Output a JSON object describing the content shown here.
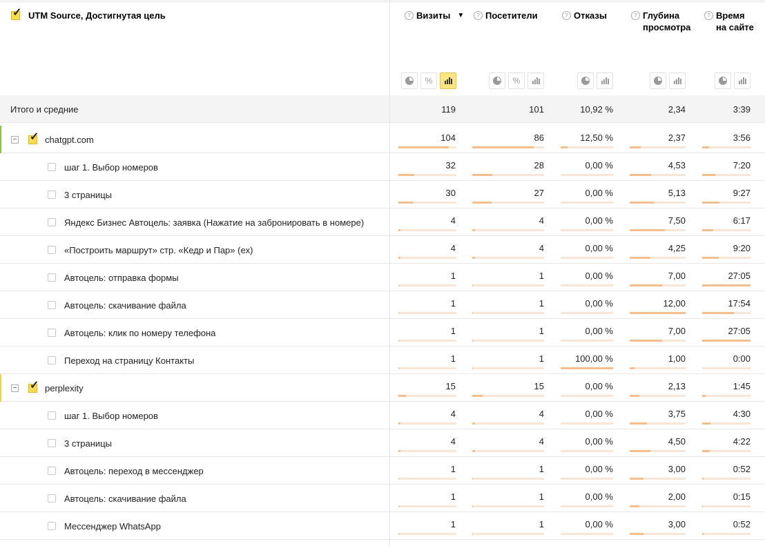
{
  "colors": {
    "accent": "#ffdc4d",
    "bar_bg": "#fbe6d4",
    "bar_fill": "#f5be8d",
    "group1_marker": "#8bc34a",
    "group2_marker": "#f1d34a"
  },
  "header": {
    "dimension": "UTM Source, Достигнутая цель",
    "help_icon": "?",
    "sort_indicator": "▼",
    "metrics": [
      {
        "title": "Визиты",
        "buttons": [
          "pie-icon",
          "percent-icon",
          "bars-icon"
        ],
        "active": "bars-icon",
        "sorted": true
      },
      {
        "title": "Посетители",
        "buttons": [
          "pie-icon",
          "percent-icon",
          "bars-icon"
        ]
      },
      {
        "title": "Отказы",
        "buttons": [
          "pie-icon",
          "bars-icon"
        ]
      },
      {
        "title": "Глубина просмотра",
        "buttons": [
          "pie-icon",
          "bars-icon"
        ]
      },
      {
        "title": "Время на сайте",
        "buttons": [
          "pie-icon",
          "bars-icon"
        ]
      }
    ]
  },
  "total": {
    "label": "Итого и средние",
    "values": [
      "119",
      "101",
      "10,92 %",
      "2,34",
      "3:39"
    ]
  },
  "groups": [
    {
      "label": "chatgpt.com",
      "values": [
        "104",
        "86",
        "12,50 %",
        "2,37",
        "3:56"
      ],
      "fills": [
        0.874,
        0.851,
        0.125,
        0.197,
        0.145
      ],
      "rows": [
        {
          "label": "шаг 1. Выбор номеров",
          "values": [
            "32",
            "28",
            "0,00 %",
            "4,53",
            "7:20"
          ],
          "fills": [
            0.269,
            0.277,
            0,
            0.378,
            0.272
          ]
        },
        {
          "label": "3 страницы",
          "values": [
            "30",
            "27",
            "0,00 %",
            "5,13",
            "9:27"
          ],
          "fills": [
            0.252,
            0.267,
            0,
            0.428,
            0.35
          ]
        },
        {
          "label": "Яндекс Бизнес Автоцель: заявка (Нажатие на забронировать в номере)",
          "values": [
            "4",
            "4",
            "0,00 %",
            "7,50",
            "6:17"
          ],
          "fills": [
            0.034,
            0.04,
            0,
            0.625,
            0.233
          ]
        },
        {
          "label": "«Построить маршрут» стр. «Кедр и Пар» (ex)",
          "values": [
            "4",
            "4",
            "0,00 %",
            "4,25",
            "9:20"
          ],
          "fills": [
            0.034,
            0.04,
            0,
            0.354,
            0.346
          ]
        },
        {
          "label": "Автоцель: отправка формы",
          "values": [
            "1",
            "1",
            "0,00 %",
            "7,00",
            "27:05"
          ],
          "fills": [
            0.008,
            0.01,
            0,
            0.583,
            1.0
          ]
        },
        {
          "label": "Автоцель: скачивание файла",
          "values": [
            "1",
            "1",
            "0,00 %",
            "12,00",
            "17:54"
          ],
          "fills": [
            0.008,
            0.01,
            0,
            1.0,
            0.661
          ]
        },
        {
          "label": "Автоцель: клик по номеру телефона",
          "values": [
            "1",
            "1",
            "0,00 %",
            "7,00",
            "27:05"
          ],
          "fills": [
            0.008,
            0.01,
            0,
            0.583,
            1.0
          ]
        },
        {
          "label": "Переход на страницу Контакты",
          "values": [
            "1",
            "1",
            "100,00 %",
            "1,00",
            "0:00"
          ],
          "fills": [
            0.008,
            0.01,
            1.0,
            0.083,
            0
          ]
        }
      ]
    },
    {
      "label": "perplexity",
      "values": [
        "15",
        "15",
        "0,00 %",
        "2,13",
        "1:45"
      ],
      "fills": [
        0.126,
        0.149,
        0,
        0.178,
        0.065
      ],
      "rows": [
        {
          "label": "шаг 1. Выбор номеров",
          "values": [
            "4",
            "4",
            "0,00 %",
            "3,75",
            "4:30"
          ],
          "fills": [
            0.034,
            0.04,
            0,
            0.313,
            0.166
          ]
        },
        {
          "label": "3 страницы",
          "values": [
            "4",
            "4",
            "0,00 %",
            "4,50",
            "4:22"
          ],
          "fills": [
            0.034,
            0.04,
            0,
            0.375,
            0.161
          ]
        },
        {
          "label": "Автоцель: переход в мессенджер",
          "values": [
            "1",
            "1",
            "0,00 %",
            "3,00",
            "0:52"
          ],
          "fills": [
            0.008,
            0.01,
            0,
            0.25,
            0.032
          ]
        },
        {
          "label": "Автоцель: скачивание файла",
          "values": [
            "1",
            "1",
            "0,00 %",
            "2,00",
            "0:15"
          ],
          "fills": [
            0.008,
            0.01,
            0,
            0.167,
            0.009
          ]
        },
        {
          "label": "Мессенджер WhatsApp",
          "values": [
            "1",
            "1",
            "0,00 %",
            "3,00",
            "0:52"
          ],
          "fills": [
            0.008,
            0.01,
            0,
            0.25,
            0.032
          ]
        }
      ]
    }
  ]
}
